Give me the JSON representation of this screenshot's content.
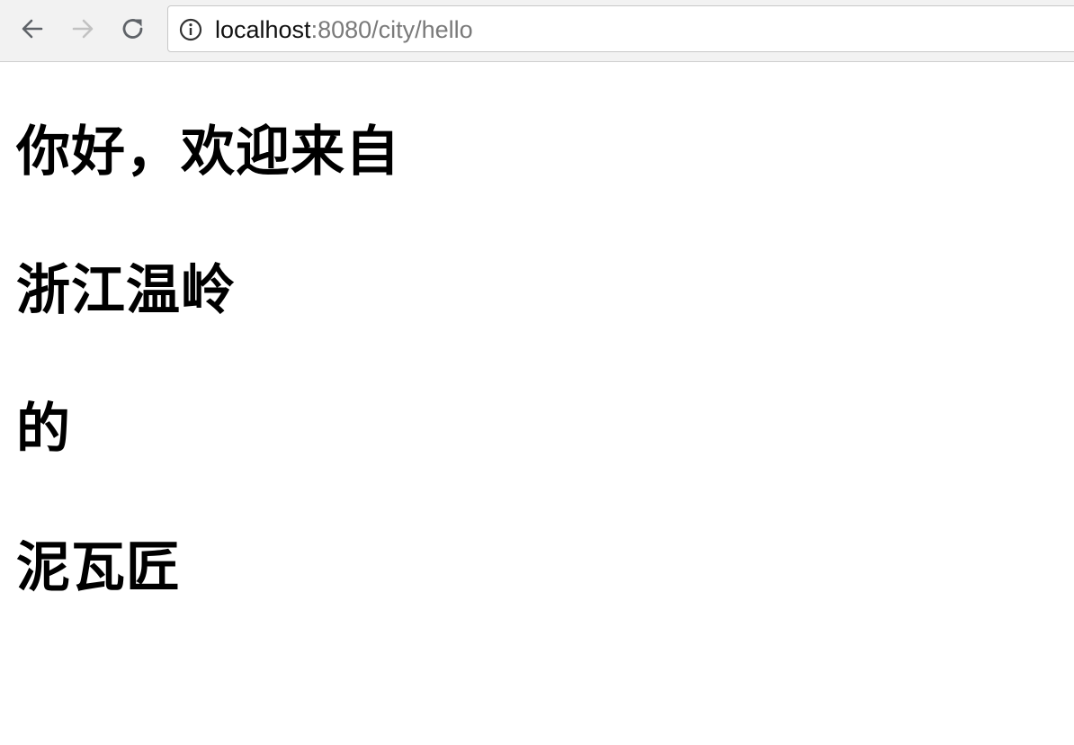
{
  "browser": {
    "icons": {
      "back": "arrow-left-icon",
      "forward": "arrow-right-icon",
      "reload": "reload-icon",
      "site_info": "info-icon"
    },
    "address": {
      "host": "localhost",
      "path": ":8080/city/hello"
    }
  },
  "page": {
    "lines": [
      "你好，欢迎来自",
      "浙江温岭",
      "的",
      "泥瓦匠"
    ]
  },
  "colors": {
    "toolbar_bg": "#f2f2f2",
    "icon_active": "#5f6368",
    "icon_disabled": "#c2c2c2",
    "text": "#000000"
  }
}
